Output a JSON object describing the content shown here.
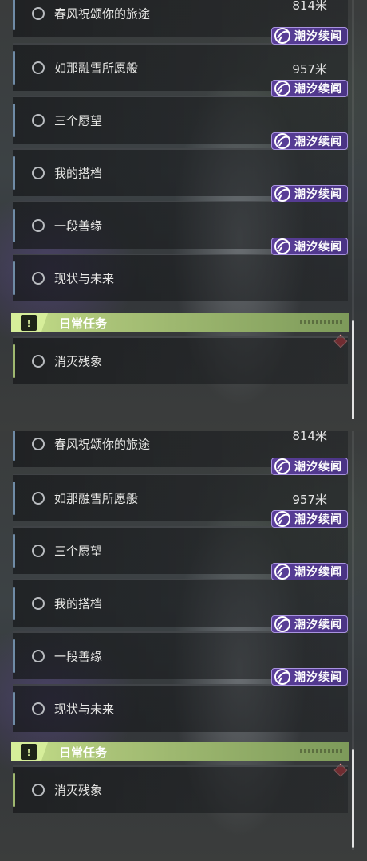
{
  "quests": [
    {
      "label": "春风祝颂你的旅途",
      "distance": "814米",
      "tag": ""
    },
    {
      "label": "如那融雪所愿般",
      "distance": "957米",
      "tag": "潮汐续闻"
    },
    {
      "label": "三个愿望",
      "distance": "",
      "tag": "潮汐续闻"
    },
    {
      "label": "我的搭档",
      "distance": "",
      "tag": "潮汐续闻"
    },
    {
      "label": "一段善缘",
      "distance": "",
      "tag": "潮汐续闻"
    },
    {
      "label": "现状与未来",
      "distance": "",
      "tag": "潮汐续闻"
    }
  ],
  "daily_section": {
    "title": "日常任务",
    "icon": "!",
    "items": [
      {
        "label": "消灭残象"
      }
    ]
  },
  "icons": {
    "quest_state": "circle-outline-icon",
    "tag_icon": "tidal-crescent-icon",
    "header_icon": "exclamation-box-icon",
    "marker": "red-diamond-icon"
  },
  "colors": {
    "tag_bg": "#5b3f9a",
    "daily_header": "#c6e08a",
    "quest_accent": "#6f8ba6",
    "marker": "#d63a42"
  }
}
